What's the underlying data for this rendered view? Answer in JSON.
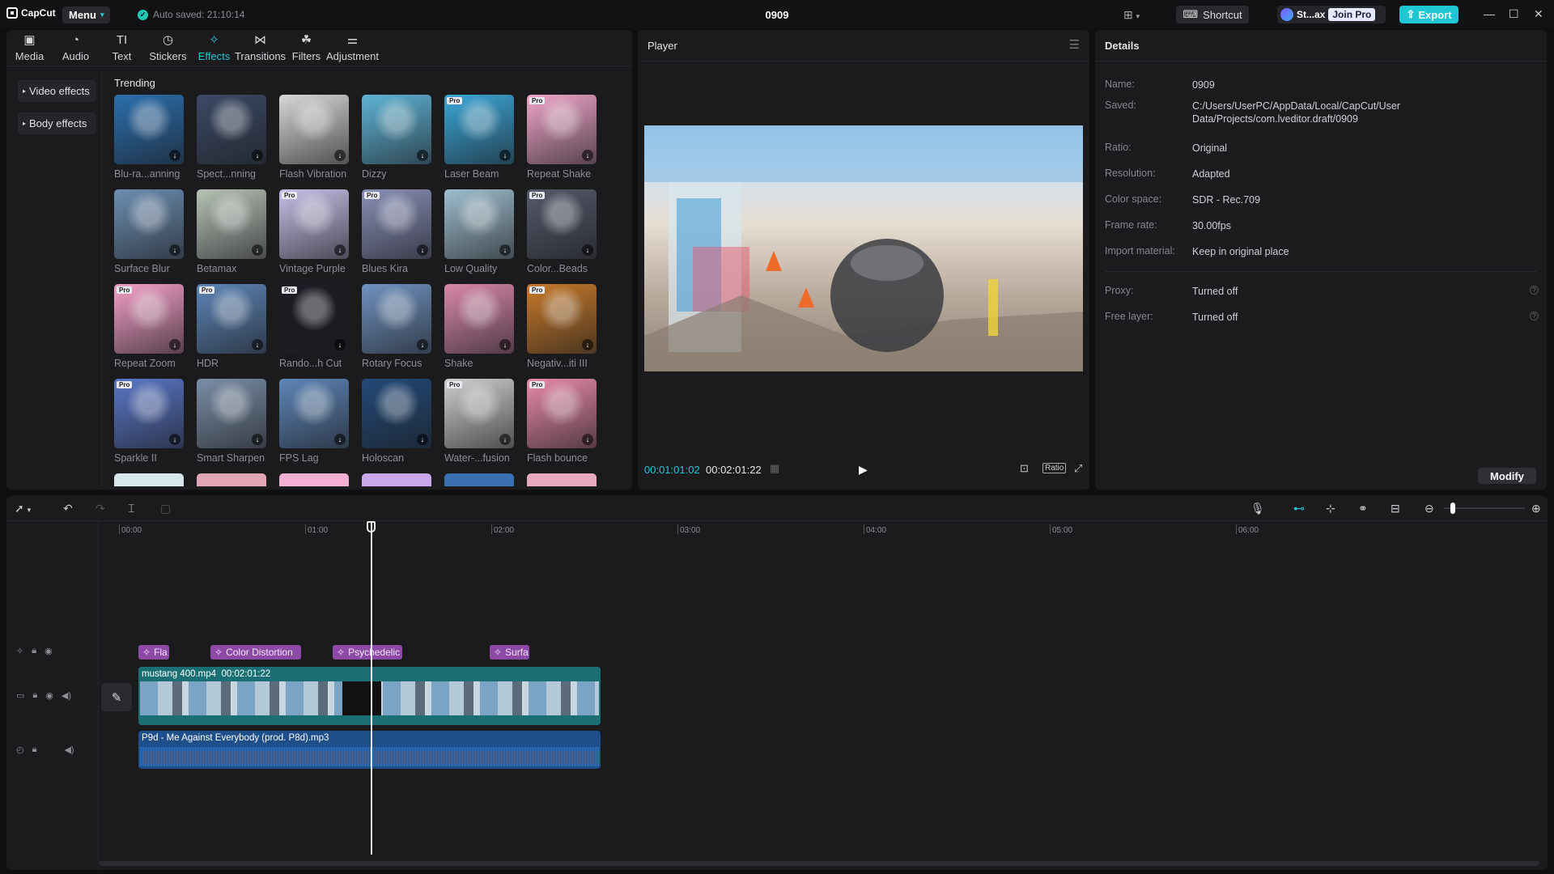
{
  "titlebar": {
    "logo": "CapCut",
    "menu_label": "Menu",
    "autosave": "Auto saved: 21:10:14",
    "project_title": "0909",
    "shortcut_label": "Shortcut",
    "user_name": "St...ax",
    "join_pro": "Join Pro",
    "export_label": "Export"
  },
  "tools": [
    {
      "label": "Media",
      "icon": "media-icon",
      "glyph": "▣"
    },
    {
      "label": "Audio",
      "icon": "audio-icon",
      "glyph": "◔"
    },
    {
      "label": "Text",
      "icon": "text-icon",
      "glyph": "TI"
    },
    {
      "label": "Stickers",
      "icon": "stickers-icon",
      "glyph": "◷"
    },
    {
      "label": "Effects",
      "icon": "effects-icon",
      "glyph": "✧",
      "active": true
    },
    {
      "label": "Transitions",
      "icon": "transitions-icon",
      "glyph": "⋈"
    },
    {
      "label": "Filters",
      "icon": "filters-icon",
      "glyph": "☘"
    },
    {
      "label": "Adjustment",
      "icon": "adjustment-icon",
      "glyph": "⚌"
    }
  ],
  "sidebar": {
    "items": [
      {
        "label": "Video effects"
      },
      {
        "label": "Body effects"
      }
    ]
  },
  "effects": {
    "section": "Trending",
    "items": [
      {
        "name": "Blu-ra...anning",
        "pro": false,
        "color": "#2b6fae"
      },
      {
        "name": "Spect...nning",
        "pro": false,
        "color": "#3b4a66"
      },
      {
        "name": "Flash Vibration",
        "pro": false,
        "color": "#d8d8d8"
      },
      {
        "name": "Dizzy",
        "pro": false,
        "color": "#5fb4d6"
      },
      {
        "name": "Laser Beam",
        "pro": true,
        "color": "#3aa7d8"
      },
      {
        "name": "Repeat Shake",
        "pro": true,
        "color": "#f0a6c8"
      },
      {
        "name": "Surface Blur",
        "pro": false,
        "color": "#6d8fb3"
      },
      {
        "name": "Betamax",
        "pro": false,
        "color": "#b8c2b6"
      },
      {
        "name": "Vintage Purple",
        "pro": true,
        "color": "#c9c0e8"
      },
      {
        "name": "Blues Kira",
        "pro": true,
        "color": "#8a90b8"
      },
      {
        "name": "Low Quality",
        "pro": false,
        "color": "#9fbfcf"
      },
      {
        "name": "Color...Beads",
        "pro": true,
        "color": "#555a6a"
      },
      {
        "name": "Repeat Zoom",
        "pro": true,
        "color": "#f4a0c6"
      },
      {
        "name": "HDR",
        "pro": true,
        "color": "#5d86b8"
      },
      {
        "name": "Rando...h Cut",
        "pro": true,
        "color": "#1c1c24"
      },
      {
        "name": "Rotary Focus",
        "pro": false,
        "color": "#6f92c0"
      },
      {
        "name": "Shake",
        "pro": false,
        "color": "#d989a8"
      },
      {
        "name": "Negativ...iti III",
        "pro": true,
        "color": "#c77a2a"
      },
      {
        "name": "Sparkle II",
        "pro": true,
        "color": "#5a78c8"
      },
      {
        "name": "Smart Sharpen",
        "pro": false,
        "color": "#7b8fa8"
      },
      {
        "name": "FPS Lag",
        "pro": false,
        "color": "#5d86b8"
      },
      {
        "name": "Holoscan",
        "pro": false,
        "color": "#224a78"
      },
      {
        "name": "Water-...fusion",
        "pro": true,
        "color": "#cfcfcf"
      },
      {
        "name": "Flash bounce",
        "pro": true,
        "color": "#e88aa8"
      }
    ],
    "partial_row_colors": [
      "#d8e6ee",
      "#e0a6b6",
      "#f4b0d4",
      "#c8a8e8",
      "#3a6fb0",
      "#e8a8c0"
    ]
  },
  "player": {
    "title": "Player",
    "current_time": "00:01:01:02",
    "total_time": "00:02:01:22",
    "ratio_label": "Ratio"
  },
  "details": {
    "title": "Details",
    "rows": [
      {
        "key": "Name:",
        "value": "0909"
      },
      {
        "key": "Saved:",
        "value": "C:/Users/UserPC/AppData/Local/CapCut/User Data/Projects/com.lveditor.draft/0909"
      },
      {
        "key": "Ratio:",
        "value": "Original"
      },
      {
        "key": "Resolution:",
        "value": "Adapted"
      },
      {
        "key": "Color space:",
        "value": "SDR - Rec.709"
      },
      {
        "key": "Frame rate:",
        "value": "30.00fps"
      },
      {
        "key": "Import material:",
        "value": "Keep in original place"
      },
      {
        "key": "Proxy:",
        "value": "Turned off"
      },
      {
        "key": "Free layer:",
        "value": "Turned off"
      }
    ],
    "modify_label": "Modify"
  },
  "timeline": {
    "ruler": [
      "00:00",
      "01:00",
      "02:00",
      "03:00",
      "04:00",
      "05:00",
      "06:00"
    ],
    "effect_chips": [
      "Fla",
      "Color Distortion",
      "Psychedelic",
      "Surfa"
    ],
    "video_clip": {
      "name": "mustang 400.mp4",
      "duration": "00:02:01:22"
    },
    "audio_clip": {
      "name": "P9d - Me Against Everybody (prod. P8d).mp3"
    }
  }
}
